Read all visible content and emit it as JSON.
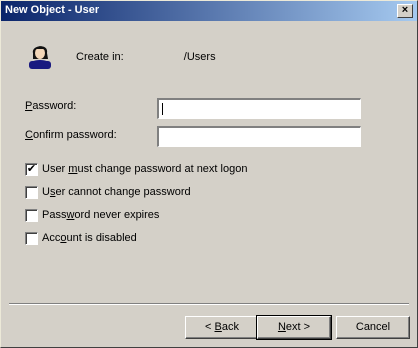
{
  "window": {
    "title": "New Object - User",
    "close_glyph": "×"
  },
  "header": {
    "icon": "user-icon",
    "create_in_label": "Create in:",
    "path_blurred": "              ",
    "path_suffix": "/Users"
  },
  "form": {
    "password": {
      "label_prefix": "",
      "label_accel": "P",
      "label_rest": "assword:",
      "value": ""
    },
    "confirm": {
      "label_prefix": "",
      "label_accel": "C",
      "label_rest": "onfirm password:",
      "value": ""
    }
  },
  "options": [
    {
      "prefix": "User ",
      "accel": "m",
      "rest": "ust change password at next logon",
      "checked": true
    },
    {
      "prefix": "U",
      "accel": "s",
      "rest": "er cannot change password",
      "checked": false
    },
    {
      "prefix": "Pass",
      "accel": "w",
      "rest": "ord never expires",
      "checked": false
    },
    {
      "prefix": "Acc",
      "accel": "o",
      "rest": "unt is disabled",
      "checked": false
    }
  ],
  "buttons": {
    "back": {
      "prefix": "< ",
      "accel": "B",
      "rest": "ack"
    },
    "next": {
      "prefix": "",
      "accel": "N",
      "rest": "ext >"
    },
    "cancel": {
      "label": "Cancel"
    }
  }
}
